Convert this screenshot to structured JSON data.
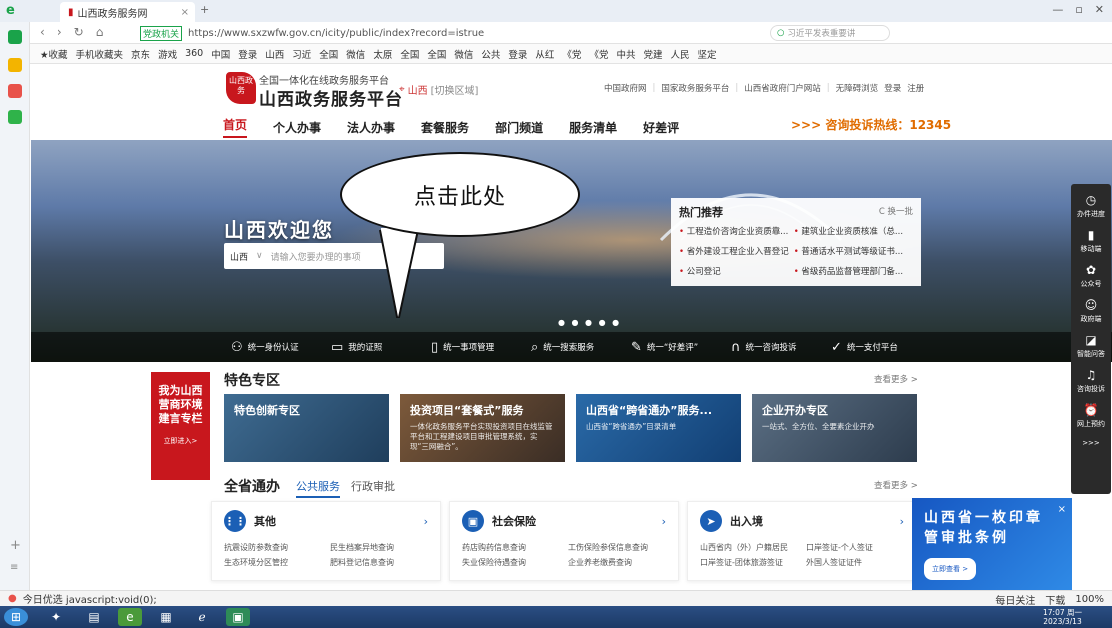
{
  "browser": {
    "tab_title": "山西政务服务网",
    "tab_close": "×",
    "new_tab": "+",
    "url_label": "党政机关",
    "url": "https://www.sxzwfw.gov.cn/icity/public/index?record=istrue",
    "search_placeholder": "习近平发表重要讲",
    "bookmarks": [
      "★收藏",
      "手机收藏夹",
      "京东",
      "游戏",
      "360",
      "中国",
      "登录",
      "山西",
      "习近",
      "全国",
      "微信",
      "太原",
      "全国",
      "全国",
      "微信",
      "公共",
      "登录",
      "从红",
      "《党",
      "《党",
      "中共",
      "党建",
      "人民",
      "坚定"
    ]
  },
  "header": {
    "logo_text": "山西政务",
    "subtitle": "全国一体化在线政务服务平台",
    "title": "山西政务服务平台",
    "region": "山西",
    "region_switch": "[切换区域]",
    "links": [
      "中国政府网",
      "国家政务服务平台",
      "山西省政府门户网站",
      "无障碍浏览",
      "登录",
      "注册"
    ]
  },
  "nav": {
    "items": [
      "首页",
      "个人办事",
      "法人办事",
      "套餐服务",
      "部门频道",
      "服务清单",
      "好差评"
    ],
    "hotline": ">>> 咨询投诉热线：12345"
  },
  "banner": {
    "welcome": "山西欢迎您",
    "search_scope": "山西",
    "search_placeholder": "请输入您要办理的事项",
    "dots": "● ● ● ● ●",
    "hot": {
      "title": "热门推荐",
      "refresh": "C 换一批",
      "items": [
        "工程造价咨询企业资质靠...",
        "建筑业企业资质核准（总...",
        "省外建设工程企业入晋登记",
        "普通话水平测试等级证书...",
        "公司登记",
        "省级药品监督管理部门备..."
      ]
    },
    "services": [
      "统一身份认证",
      "我的证照",
      "统一事项管理",
      "统一搜索服务",
      "统一“好差评”",
      "统一咨询投诉",
      "统一支付平台"
    ]
  },
  "callout": {
    "text": "点击此处"
  },
  "right_float": [
    "办件进度",
    "移动端",
    "公众号",
    "政府端",
    "智能问答",
    "咨询投诉",
    "网上预约"
  ],
  "special": {
    "promo_lines": [
      "我为山西",
      "营商环境",
      "建言专栏"
    ],
    "promo_btn": "立即进入>",
    "title": "特色专区",
    "more": "查看更多 >",
    "cards": [
      {
        "title": "特色创新专区",
        "desc": ""
      },
      {
        "title": "投资项目“套餐式”服务",
        "desc": "一体化政务服务平台实现投资项目在线监管平台和工程建设项目审批管理系统，实现“三网融合”。"
      },
      {
        "title": "山西省“跨省通办”服务...",
        "desc": "山西省“跨省通办”目录清单"
      },
      {
        "title": "企业开办专区",
        "desc": "一站式、全方位、全要素企业开办"
      }
    ]
  },
  "province": {
    "title": "全省通办",
    "tab_public": "公共服务",
    "tab_admin": "行政审批",
    "more": "查看更多 >",
    "cards": [
      {
        "title": "其他",
        "links": [
          "抗震设防参数查询",
          "民生档案异地查询",
          "生态环境分区管控",
          "肥料登记信息查询"
        ]
      },
      {
        "title": "社会保险",
        "links": [
          "药店购药信息查询",
          "工伤保险参保信息查询",
          "失业保险待遇查询",
          "企业养老缴费查询"
        ]
      },
      {
        "title": "出入境",
        "links": [
          "山西省内（外）户籍居民",
          "口岸签证-个人签证",
          "口岸签证-团体旅游签证",
          "外国人签证证件"
        ]
      }
    ]
  },
  "ad": {
    "lines": [
      "山西省一枚印章",
      "管审批条例"
    ],
    "btn": "立即查看 >",
    "close": "×"
  },
  "status": {
    "left": "今日优选  javascript:void(0);",
    "right": [
      "每日关注",
      "下载",
      "100%"
    ]
  },
  "taskbar": {
    "time": "17:07 周一",
    "date": "2023/3/13"
  }
}
